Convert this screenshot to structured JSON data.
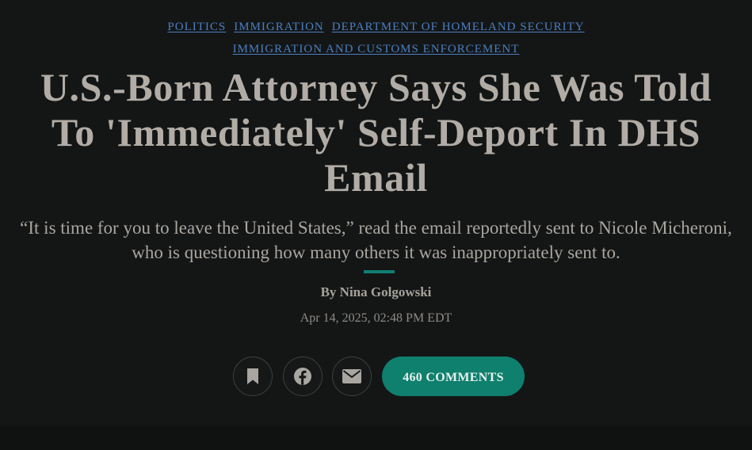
{
  "tags": {
    "row1": [
      "POLITICS",
      "IMMIGRATION",
      "DEPARTMENT OF HOMELAND SECURITY"
    ],
    "row2": [
      "IMMIGRATION AND CUSTOMS ENFORCEMENT"
    ]
  },
  "article": {
    "headline": "U.S.-Born Attorney Says She Was Told To 'Immediately' Self-Deport In DHS Email",
    "dek": "“It is time for you to leave the United States,” read the email reportedly sent to Nicole Micheroni, who is questioning how many others it was inappropriately sent to.",
    "byline_prefix": "By",
    "author": "Nina Golgowski",
    "timestamp": "Apr 14, 2025, 02:48 PM EDT"
  },
  "actions": {
    "comments_label": "460 COMMENTS"
  },
  "icons": {
    "save": "bookmark-icon",
    "facebook": "facebook-icon",
    "email": "envelope-icon"
  },
  "colors": {
    "background": "#141616",
    "tag_link": "#4b7fc2",
    "accent": "#0f7f6e",
    "headline": "#b1aca6"
  }
}
